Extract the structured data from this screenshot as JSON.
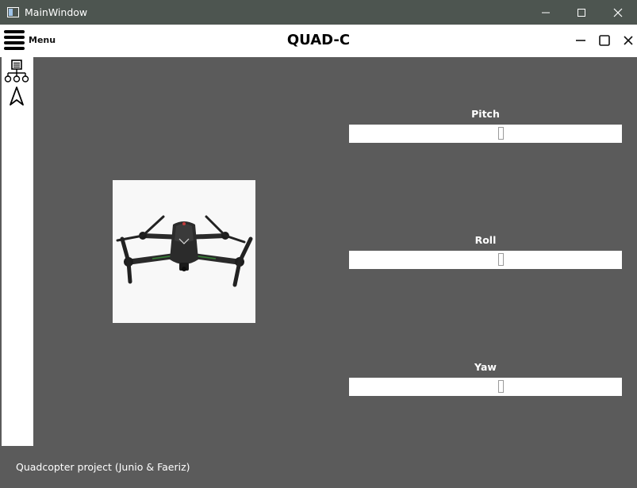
{
  "window": {
    "title": "MainWindow"
  },
  "header": {
    "menu_label": "Menu",
    "app_title": "QUAD-C"
  },
  "sidebar": {
    "icons": [
      "org-chart-icon",
      "navigation-arrow-icon"
    ]
  },
  "gauges": [
    {
      "label": "Pitch",
      "value": ""
    },
    {
      "label": "Roll",
      "value": ""
    },
    {
      "label": "Yaw",
      "value": ""
    }
  ],
  "footer": {
    "text": "Quadcopter project (Junio & Faeriz)"
  },
  "colors": {
    "background": "#5b5b5b",
    "titlebar": "#4d5550",
    "panel": "#ffffff"
  }
}
